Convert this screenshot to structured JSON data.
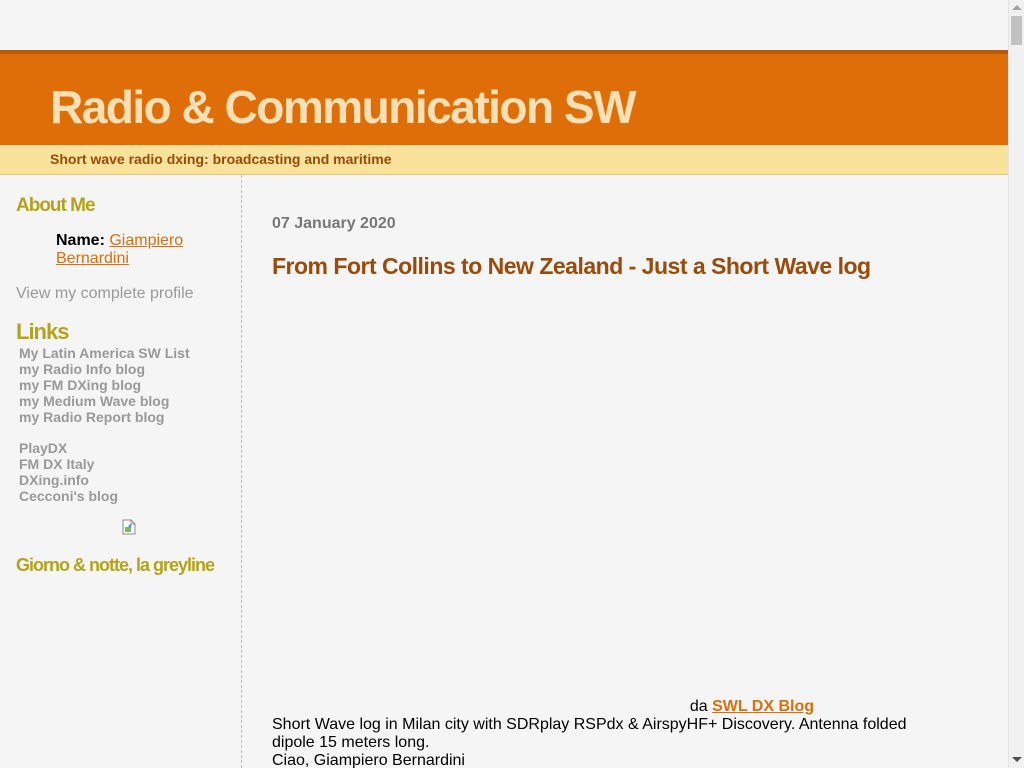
{
  "header": {
    "title": "Radio & Communication SW",
    "description": "Short wave radio dxing: broadcasting and maritime"
  },
  "sidebar": {
    "about_title": "About Me",
    "name_label": "Name:",
    "name_value": "Giampiero Bernardini",
    "profile_link": "View my complete profile",
    "links_title": "Links",
    "links_group1": [
      "My Latin America SW List",
      "my Radio Info blog",
      "my FM DXing blog",
      "my Medium Wave blog",
      "my Radio Report blog"
    ],
    "links_group2": [
      "PlayDX",
      "FM DX Italy",
      "DXing.info",
      "Cecconi's blog"
    ],
    "greyline_title": "Giorno & notte, la greyline"
  },
  "post": {
    "date": "07 January 2020",
    "title": "From Fort Collins to New Zealand - Just a Short Wave log",
    "source_prefix": "da",
    "source_link": "SWL DX Blog",
    "body_line1": "Short Wave log in Milan city with SDRplay RSPdx & AirspyHF+ Discovery. Antenna folded dipole 15 meters long.",
    "body_line2": "Ciao, Giampiero Bernardini"
  },
  "colors": {
    "header_orange": "#df6e08",
    "title_cream": "#fbe0b5",
    "desc_yellow": "#f8e29c",
    "sidebar_heading": "#b3a31a",
    "post_title": "#9a4a09"
  }
}
